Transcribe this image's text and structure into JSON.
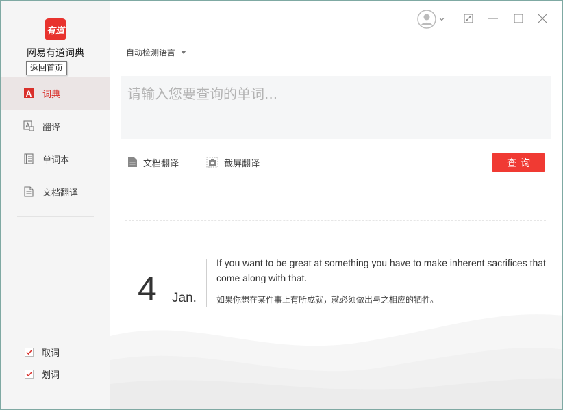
{
  "app": {
    "name": "网易有道词典",
    "logo_text": "有道",
    "accent_color": "#f03a33"
  },
  "tooltip": {
    "text": "返回首页"
  },
  "sidebar": {
    "items": [
      {
        "label": "词典",
        "icon": "dictionary-icon",
        "active": true
      },
      {
        "label": "翻译",
        "icon": "translate-icon",
        "active": false
      },
      {
        "label": "单词本",
        "icon": "wordbook-icon",
        "active": false
      },
      {
        "label": "文档翻译",
        "icon": "document-translate-icon",
        "active": false
      }
    ],
    "checks": [
      {
        "label": "取词",
        "checked": true
      },
      {
        "label": "划词",
        "checked": true
      }
    ]
  },
  "window_controls": [
    "user-avatar-icon",
    "compact-mode-icon",
    "minimize-icon",
    "maximize-icon",
    "close-icon"
  ],
  "main": {
    "language_select": "自动检测语言",
    "search_placeholder": "请输入您要查询的单词...",
    "tools": [
      {
        "label": "文档翻译",
        "icon": "document-icon"
      },
      {
        "label": "截屏翻译",
        "icon": "screenshot-icon"
      }
    ],
    "query_button": "查询"
  },
  "daily": {
    "day": "4",
    "month": "Jan.",
    "quote_en": "If you want to be great at something you have to make inherent sacrifices that come along with that.",
    "quote_zh": "如果你想在某件事上有所成就，就必须做出与之相应的牺牲。"
  }
}
